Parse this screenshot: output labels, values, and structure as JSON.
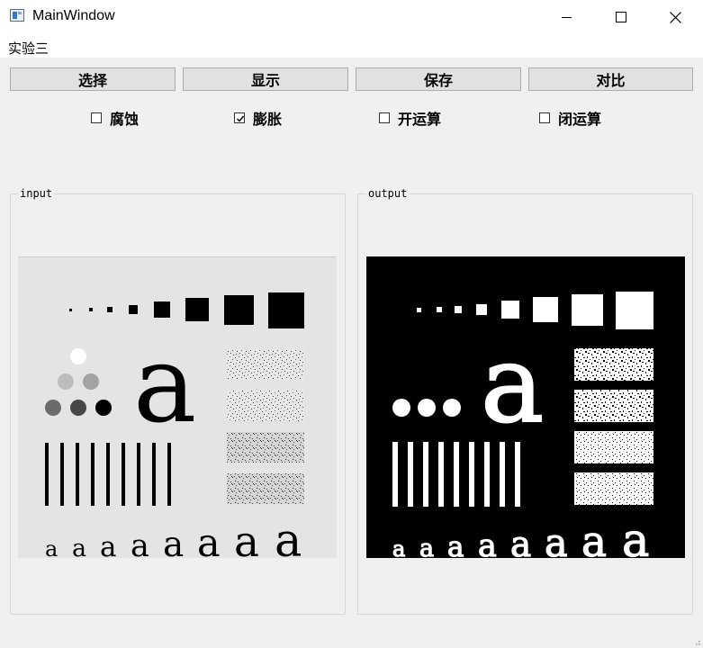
{
  "window": {
    "title": "MainWindow"
  },
  "menu": {
    "items": [
      "实验三"
    ]
  },
  "toolbar": {
    "select": "选择",
    "display": "显示",
    "save": "保存",
    "compare": "对比"
  },
  "options": [
    {
      "label": "腐蚀",
      "checked": false
    },
    {
      "label": "膨胀",
      "checked": true
    },
    {
      "label": "开运算",
      "checked": false
    },
    {
      "label": "闭运算",
      "checked": false
    }
  ],
  "panels": {
    "input_title": "input",
    "output_title": "output"
  },
  "image": {
    "glyph": "a"
  },
  "colors": {
    "window_bg": "#f0f0f0",
    "input_bg": "#e4e4e4",
    "output_bg": "#000000"
  }
}
